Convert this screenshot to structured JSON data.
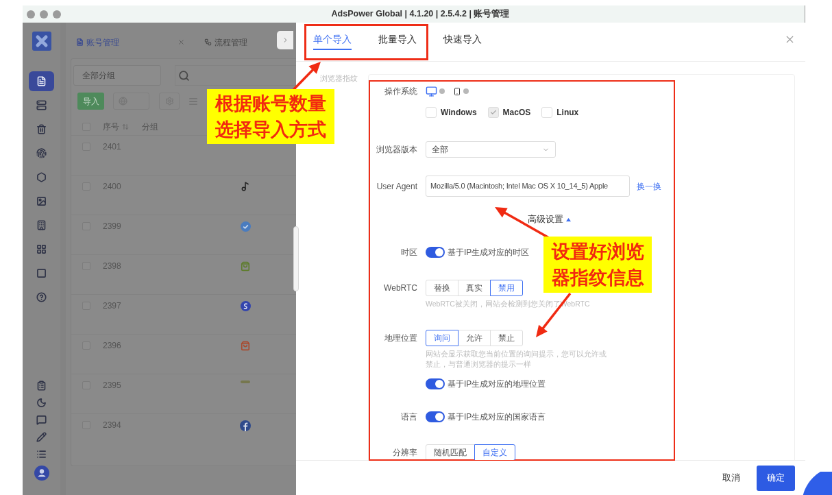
{
  "window": {
    "title": "AdsPower Global | 4.1.20 | 2.5.4.2 | 账号管理"
  },
  "sidebar": {
    "items": [
      {
        "selected": true
      },
      {
        "selected": false
      },
      {
        "selected": false
      },
      {
        "selected": false
      },
      {
        "selected": false
      },
      {
        "selected": false
      },
      {
        "selected": false
      },
      {
        "selected": false
      },
      {
        "selected": false
      },
      {
        "selected": false
      }
    ]
  },
  "background_page": {
    "tabs": [
      {
        "label": "账号管理",
        "selected": true,
        "closable": true
      },
      {
        "label": "流程管理",
        "selected": false,
        "closable": false
      }
    ],
    "group_filter": {
      "value": "全部分组"
    },
    "import_button": "导入",
    "table": {
      "all_checked": false,
      "columns": [
        {
          "label": "序号",
          "sortable": true
        },
        {
          "label": "分组",
          "sortable": false
        }
      ],
      "rows": [
        {
          "number": "2401",
          "checked": false
        },
        {
          "number": "2400",
          "checked": false
        },
        {
          "number": "2399",
          "checked": false
        },
        {
          "number": "2398",
          "checked": false
        },
        {
          "number": "2397",
          "checked": false
        },
        {
          "number": "2396",
          "checked": false
        },
        {
          "number": "2395",
          "checked": false
        },
        {
          "number": "2394",
          "checked": false
        }
      ]
    }
  },
  "import_dialog": {
    "tabs": [
      {
        "label": "单个导入",
        "selected": true
      },
      {
        "label": "批量导入",
        "selected": false
      },
      {
        "label": "快速导入",
        "selected": false
      }
    ],
    "section_label": "浏览器指纹",
    "fields": [
      {
        "kind": "os",
        "label": "操作系统",
        "devices": [
          {
            "selected": true
          },
          {
            "selected": false
          }
        ],
        "options": [
          {
            "label": "Windows",
            "checked": false
          },
          {
            "label": "MacOS",
            "checked": true
          },
          {
            "label": "Linux",
            "checked": false
          }
        ]
      },
      {
        "kind": "select",
        "label": "浏览器版本",
        "value": "全部"
      },
      {
        "kind": "input",
        "label": "User Agent",
        "value": "Mozilla/5.0 (Macintosh; Intel Mac OS X 10_14_5) Apple",
        "action": "换一换"
      },
      {
        "kind": "expander",
        "label": "高级设置",
        "expanded": true
      },
      {
        "kind": "switch",
        "label": "时区",
        "on": true,
        "text": "基于IP生成对应的时区"
      },
      {
        "kind": "segmented",
        "label": "WebRTC",
        "options": [
          {
            "label": "替换",
            "selected": false
          },
          {
            "label": "真实",
            "selected": false
          },
          {
            "label": "禁用",
            "selected": true
          }
        ],
        "hint": "WebRTC被关闭，网站会检测到您关闭了WebRTC"
      },
      {
        "kind": "segmented",
        "label": "地理位置",
        "options": [
          {
            "label": "询问",
            "selected": true
          },
          {
            "label": "允许",
            "selected": false
          },
          {
            "label": "禁止",
            "selected": false
          }
        ],
        "hint": "网站会显示获取您当前位置的询问提示，您可以允许或禁止，与普通浏览器的提示一样",
        "switch": {
          "on": true,
          "text": "基于IP生成对应的地理位置"
        }
      },
      {
        "kind": "switch",
        "label": "语言",
        "on": true,
        "text": "基于IP生成对应的国家语言"
      },
      {
        "kind": "segmented",
        "label": "分辨率",
        "options": [
          {
            "label": "随机匹配",
            "selected": false
          },
          {
            "label": "自定义",
            "selected": true
          }
        ]
      }
    ],
    "footer": {
      "cancel": "取消",
      "confirm": "确定"
    }
  },
  "annotations": [
    {
      "text": "根据账号数量选择导入方式"
    },
    {
      "text": "设置好浏览器指纹信息"
    }
  ]
}
